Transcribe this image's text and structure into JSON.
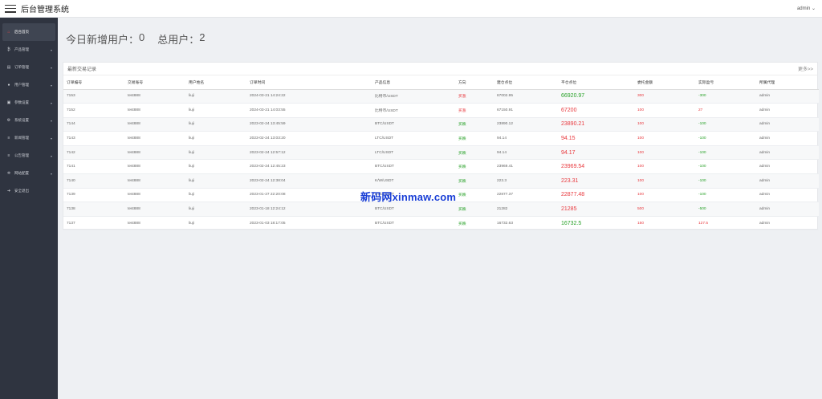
{
  "header": {
    "title": "后台管理系统",
    "user": "admin ⌄"
  },
  "sidebar": {
    "items": [
      {
        "label": "后台首页",
        "icon": "home-icon",
        "glyph": "⌂",
        "arrow": false,
        "active": true
      },
      {
        "label": "产品管理",
        "icon": "bitcoin-icon",
        "glyph": "₿",
        "arrow": true
      },
      {
        "label": "订单管理",
        "icon": "document-icon",
        "glyph": "▤",
        "arrow": true
      },
      {
        "label": "用户管理",
        "icon": "user-icon",
        "glyph": "●",
        "arrow": true
      },
      {
        "label": "参数设置",
        "icon": "clipboard-icon",
        "glyph": "▣",
        "arrow": true
      },
      {
        "label": "系统设置",
        "icon": "gears-icon",
        "glyph": "⚙",
        "arrow": true
      },
      {
        "label": "新闻管理",
        "icon": "list-icon",
        "glyph": "≡",
        "arrow": true
      },
      {
        "label": "公告管理",
        "icon": "list-icon",
        "glyph": "≡",
        "arrow": true
      },
      {
        "label": "网站配置",
        "icon": "gear-icon",
        "glyph": "✲",
        "arrow": true
      },
      {
        "label": "安全退出",
        "icon": "logout-icon",
        "glyph": "➜",
        "arrow": false
      }
    ]
  },
  "stats": {
    "new_users_label": "今日新增用户：",
    "new_users_value": "0",
    "total_users_label": "总用户：",
    "total_users_value": "2"
  },
  "trades": {
    "title": "最新交易记录",
    "more": "更多>>",
    "columns": [
      "订单编号",
      "交易账号",
      "用户姓名",
      "订单时间",
      "产品信息",
      "方向",
      "建仓点位",
      "平仓点位",
      "委托金额",
      "实际盈亏",
      "所属代理"
    ],
    "rows": [
      [
        "7153",
        "test888",
        "liuji",
        "2024-03-21 14:24:22",
        "比特币/USDT",
        "买涨",
        "67002.95",
        "66920.97",
        "300",
        "-300",
        "admin"
      ],
      [
        "7152",
        "test888",
        "liuji",
        "2024-03-21 14:03:55",
        "比特币/USDT",
        "买涨",
        "67150.91",
        "67200",
        "100",
        "27",
        "admin"
      ],
      [
        "7144",
        "test888",
        "liuji",
        "2023-02-24 13:45:59",
        "BTC/USDT",
        "买跌",
        "23890.12",
        "23890.21",
        "100",
        "-100",
        "admin"
      ],
      [
        "7143",
        "test888",
        "liuji",
        "2023-02-24 13:03:20",
        "LTC/USDT",
        "买跌",
        "94.14",
        "94.15",
        "100",
        "-100",
        "admin"
      ],
      [
        "7142",
        "test888",
        "liuji",
        "2023-02-24 12:57:12",
        "LTC/USDT",
        "买跌",
        "94.14",
        "94.17",
        "100",
        "-100",
        "admin"
      ],
      [
        "7141",
        "test888",
        "liuji",
        "2023-02-24 12:45:23",
        "BTC/USDT",
        "买跌",
        "23969.41",
        "23969.54",
        "100",
        "-100",
        "admin"
      ],
      [
        "7140",
        "test888",
        "liuji",
        "2023-02-24 12:38:04",
        "K/W/USDT",
        "买跌",
        "223.3",
        "223.31",
        "100",
        "-100",
        "admin"
      ],
      [
        "7139",
        "test888",
        "liuji",
        "2023-01-27 22:20:08",
        "BTC/USDT",
        "买跌",
        "22877.37",
        "22877.48",
        "100",
        "-100",
        "admin"
      ],
      [
        "7138",
        "test888",
        "liuji",
        "2023-01-18 12:24:12",
        "BTC/USDT",
        "买跌",
        "21282",
        "21285",
        "500",
        "-500",
        "admin"
      ],
      [
        "7137",
        "test888",
        "liuji",
        "2023-01-03 18:17:05",
        "BTC/USDT",
        "买跌",
        "16732.63",
        "16732.5",
        "150",
        "127.5",
        "admin"
      ]
    ],
    "row_colors": [
      {
        "dir": "red",
        "close": "green",
        "amount": "red",
        "pnl": "green"
      },
      {
        "dir": "red",
        "close": "red",
        "amount": "red",
        "pnl": "red"
      },
      {
        "dir": "green",
        "close": "red",
        "amount": "red",
        "pnl": "green"
      },
      {
        "dir": "green",
        "close": "red",
        "amount": "red",
        "pnl": "green"
      },
      {
        "dir": "green",
        "close": "red",
        "amount": "red",
        "pnl": "green"
      },
      {
        "dir": "green",
        "close": "red",
        "amount": "red",
        "pnl": "green"
      },
      {
        "dir": "green",
        "close": "red",
        "amount": "red",
        "pnl": "green"
      },
      {
        "dir": "green",
        "close": "red",
        "amount": "red",
        "pnl": "green"
      },
      {
        "dir": "green",
        "close": "red",
        "amount": "red",
        "pnl": "green"
      },
      {
        "dir": "green",
        "close": "green",
        "amount": "red",
        "pnl": "red"
      }
    ]
  },
  "watermark": "新码网xinmaw.com",
  "colors": {
    "sidebar_bg": "#2f3440",
    "red": "#e8383d",
    "green": "#2aa22a"
  }
}
